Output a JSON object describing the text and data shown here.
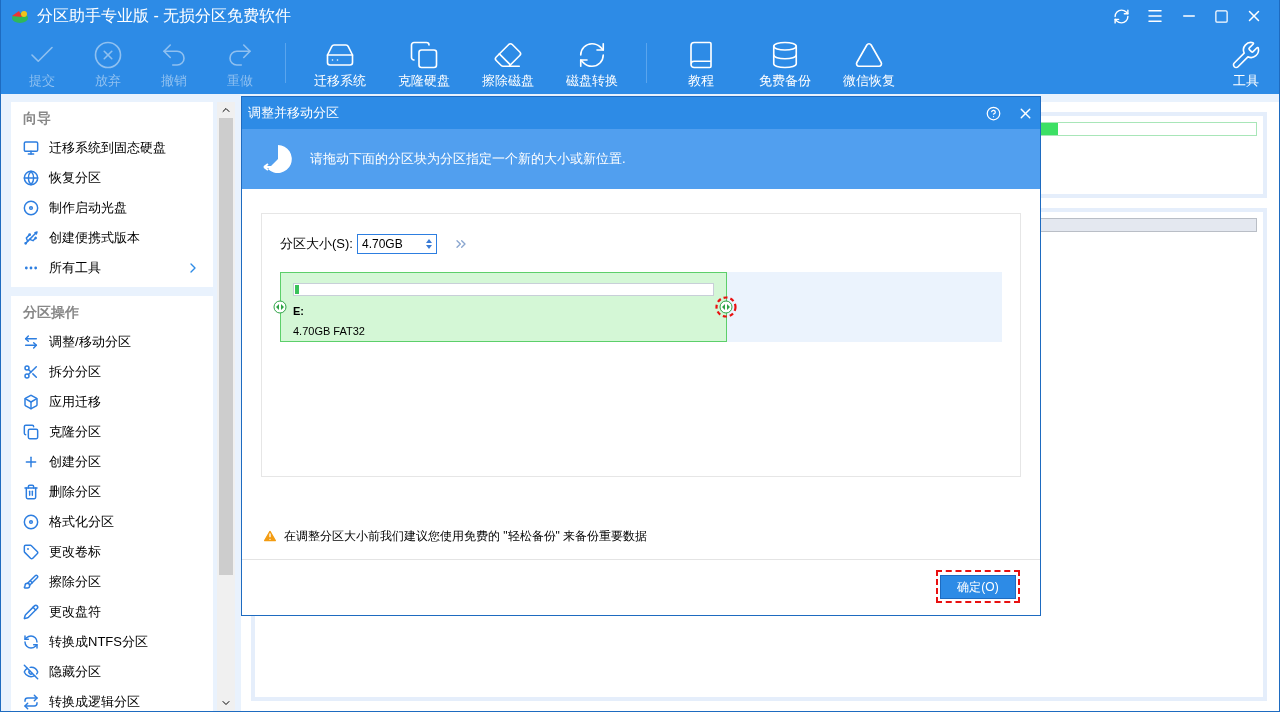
{
  "window": {
    "title": "分区助手专业版 - 无损分区免费软件"
  },
  "toolbar": {
    "groups": [
      [
        {
          "label": "提交",
          "disabled": true
        },
        {
          "label": "放弃",
          "disabled": true
        },
        {
          "label": "撤销",
          "disabled": true
        },
        {
          "label": "重做",
          "disabled": true
        }
      ],
      [
        {
          "label": "迁移系统",
          "disabled": false
        },
        {
          "label": "克隆硬盘",
          "disabled": false
        },
        {
          "label": "擦除磁盘",
          "disabled": false
        },
        {
          "label": "磁盘转换",
          "disabled": false
        }
      ],
      [
        {
          "label": "教程",
          "disabled": false
        },
        {
          "label": "免费备份",
          "disabled": false
        },
        {
          "label": "微信恢复",
          "disabled": false
        }
      ]
    ],
    "right": {
      "label": "工具",
      "disabled": false
    }
  },
  "sidebar": {
    "sections": [
      {
        "title": "向导",
        "items": [
          {
            "label": "迁移系统到固态硬盘",
            "kind": "item"
          },
          {
            "label": "恢复分区",
            "kind": "item"
          },
          {
            "label": "制作启动光盘",
            "kind": "item"
          },
          {
            "label": "创建便携式版本",
            "kind": "item"
          },
          {
            "label": "所有工具",
            "kind": "submenu"
          }
        ]
      },
      {
        "title": "分区操作",
        "items": [
          {
            "label": "调整/移动分区",
            "kind": "item"
          },
          {
            "label": "拆分分区",
            "kind": "item"
          },
          {
            "label": "应用迁移",
            "kind": "item"
          },
          {
            "label": "克隆分区",
            "kind": "item"
          },
          {
            "label": "创建分区",
            "kind": "item"
          },
          {
            "label": "删除分区",
            "kind": "item"
          },
          {
            "label": "格式化分区",
            "kind": "item"
          },
          {
            "label": "更改卷标",
            "kind": "item"
          },
          {
            "label": "擦除分区",
            "kind": "item"
          },
          {
            "label": "更改盘符",
            "kind": "item"
          },
          {
            "label": "转换成NTFS分区",
            "kind": "item"
          },
          {
            "label": "隐藏分区",
            "kind": "item"
          },
          {
            "label": "转换成逻辑分区",
            "kind": "item"
          }
        ]
      }
    ]
  },
  "dialog": {
    "title": "调整并移动分区",
    "banner": "请拖动下面的分区块为分区指定一个新的大小或新位置.",
    "size_label": "分区大小(S):",
    "size_value": "4.70GB",
    "partition": {
      "letter": "E:",
      "info": "4.70GB FAT32",
      "level": 0.01
    },
    "warning": "在调整分区大小前我们建议您使用免费的 \"轻松备份\" 来备份重要数据",
    "ok_button": "确定(O)"
  }
}
